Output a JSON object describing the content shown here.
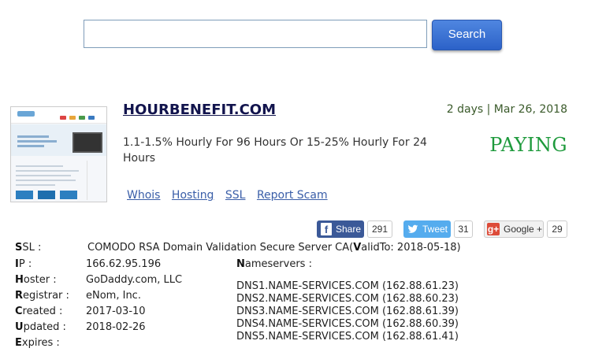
{
  "search": {
    "placeholder": "",
    "value": "",
    "button_label": "Search"
  },
  "result": {
    "title": "HOURBENEFIT.COM",
    "date": "2 days | Mar 26, 2018",
    "description": "1.1-1.5% Hourly For 96 Hours Or 15-25% Hourly For 24 Hours",
    "status": "PAYING",
    "links": [
      "Whois",
      "Hosting",
      "SSL",
      "Report Scam"
    ]
  },
  "share": {
    "facebook": {
      "label": "Share",
      "count": "291"
    },
    "twitter": {
      "label": "Tweet",
      "count": "31"
    },
    "google": {
      "label": "Google +",
      "count": "29"
    }
  },
  "info": {
    "ssl_label_first": "S",
    "ssl_label_rest": "SL :",
    "ssl_value_prefix": "COMODO RSA Domain Validation Secure Server CA(",
    "valid_first": "V",
    "valid_rest": "alidTo: 2018-05-18)",
    "ip_label_first": "I",
    "ip_label_rest": "P :",
    "ip_value": "166.62.95.196",
    "hoster_label_first": "H",
    "hoster_label_rest": "oster :",
    "hoster_value": "GoDaddy.com, LLC",
    "registrar_label_first": "R",
    "registrar_label_rest": "egistrar :",
    "registrar_value": "eNom, Inc.",
    "created_label_first": "C",
    "created_label_rest": "reated :",
    "created_value": "2017-03-10",
    "updated_label_first": "U",
    "updated_label_rest": "pdated :",
    "updated_value": "2018-02-26",
    "expires_label_first": "E",
    "expires_label_rest": "xpires :",
    "ns_label_first": "N",
    "ns_label_rest": "ameservers :",
    "nameservers": [
      "DNS1.NAME-SERVICES.COM (162.88.61.23)",
      "DNS2.NAME-SERVICES.COM (162.88.60.23)",
      "DNS3.NAME-SERVICES.COM (162.88.61.39)",
      "DNS4.NAME-SERVICES.COM (162.88.60.39)",
      "DNS5.NAME-SERVICES.COM (162.88.61.41)"
    ]
  },
  "colors": {
    "title": "#12144d",
    "status": "#1e9a3c",
    "link": "#3a5ea8",
    "facebook": "#3b5998",
    "twitter": "#55acee",
    "google": "#dd4b39"
  }
}
